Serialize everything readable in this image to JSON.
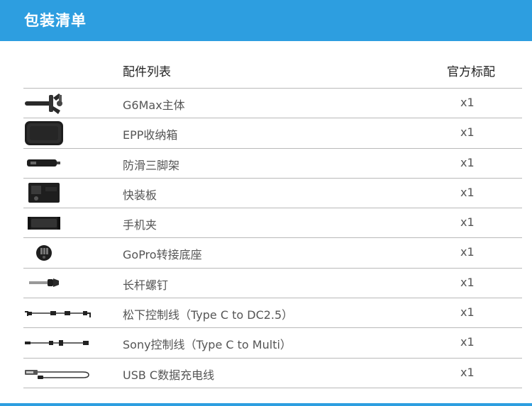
{
  "header": {
    "title": "包装清单"
  },
  "table": {
    "columns": {
      "name": "配件列表",
      "qty": "官方标配"
    },
    "rows": [
      {
        "icon": "gimbal-icon",
        "name": "G6Max主体",
        "qty": "x1"
      },
      {
        "icon": "case-icon",
        "name": "EPP收纳箱",
        "qty": "x1"
      },
      {
        "icon": "tripod-icon",
        "name": "防滑三脚架",
        "qty": "x1"
      },
      {
        "icon": "quick-release-plate-icon",
        "name": "快装板",
        "qty": "x1"
      },
      {
        "icon": "phone-clamp-icon",
        "name": "手机夹",
        "qty": "x1"
      },
      {
        "icon": "gopro-mount-icon",
        "name": "GoPro转接底座",
        "qty": "x1"
      },
      {
        "icon": "screw-icon",
        "name": "长杆螺钉",
        "qty": "x1"
      },
      {
        "icon": "panasonic-cable-icon",
        "name": "松下控制线（Type C to DC2.5）",
        "qty": "x1"
      },
      {
        "icon": "sony-cable-icon",
        "name": "Sony控制线（Type C to Multi）",
        "qty": "x1"
      },
      {
        "icon": "usb-c-cable-icon",
        "name": "USB C数据充电线",
        "qty": "x1"
      }
    ]
  },
  "colors": {
    "accent": "#2d9ee0",
    "divider": "#b9b9b9",
    "text": "#555555"
  }
}
